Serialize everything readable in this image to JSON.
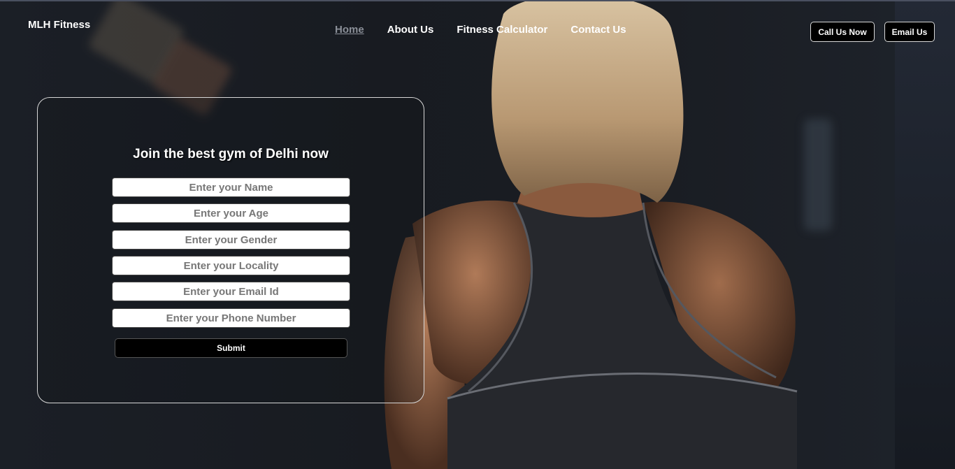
{
  "brand": {
    "name": "MLH Fitness"
  },
  "nav": {
    "items": [
      {
        "label": "Home",
        "active": true
      },
      {
        "label": "About Us",
        "active": false
      },
      {
        "label": "Fitness Calculator",
        "active": false
      },
      {
        "label": "Contact Us",
        "active": false
      }
    ]
  },
  "header_buttons": {
    "call": "Call Us Now",
    "email": "Email Us"
  },
  "form": {
    "title": "Join the best gym of Delhi now",
    "fields": {
      "name": {
        "placeholder": "Enter your Name",
        "value": ""
      },
      "age": {
        "placeholder": "Enter your Age",
        "value": ""
      },
      "gender": {
        "placeholder": "Enter your Gender",
        "value": ""
      },
      "locality": {
        "placeholder": "Enter your Locality",
        "value": ""
      },
      "email": {
        "placeholder": "Enter your Email Id",
        "value": ""
      },
      "phone": {
        "placeholder": "Enter your Phone Number",
        "value": ""
      }
    },
    "submit_label": "Submit"
  },
  "colors": {
    "background": "#15181d",
    "text": "#ffffff",
    "active_nav": "#8a8f98",
    "button_bg": "#000000",
    "border": "#d7d7d7"
  }
}
